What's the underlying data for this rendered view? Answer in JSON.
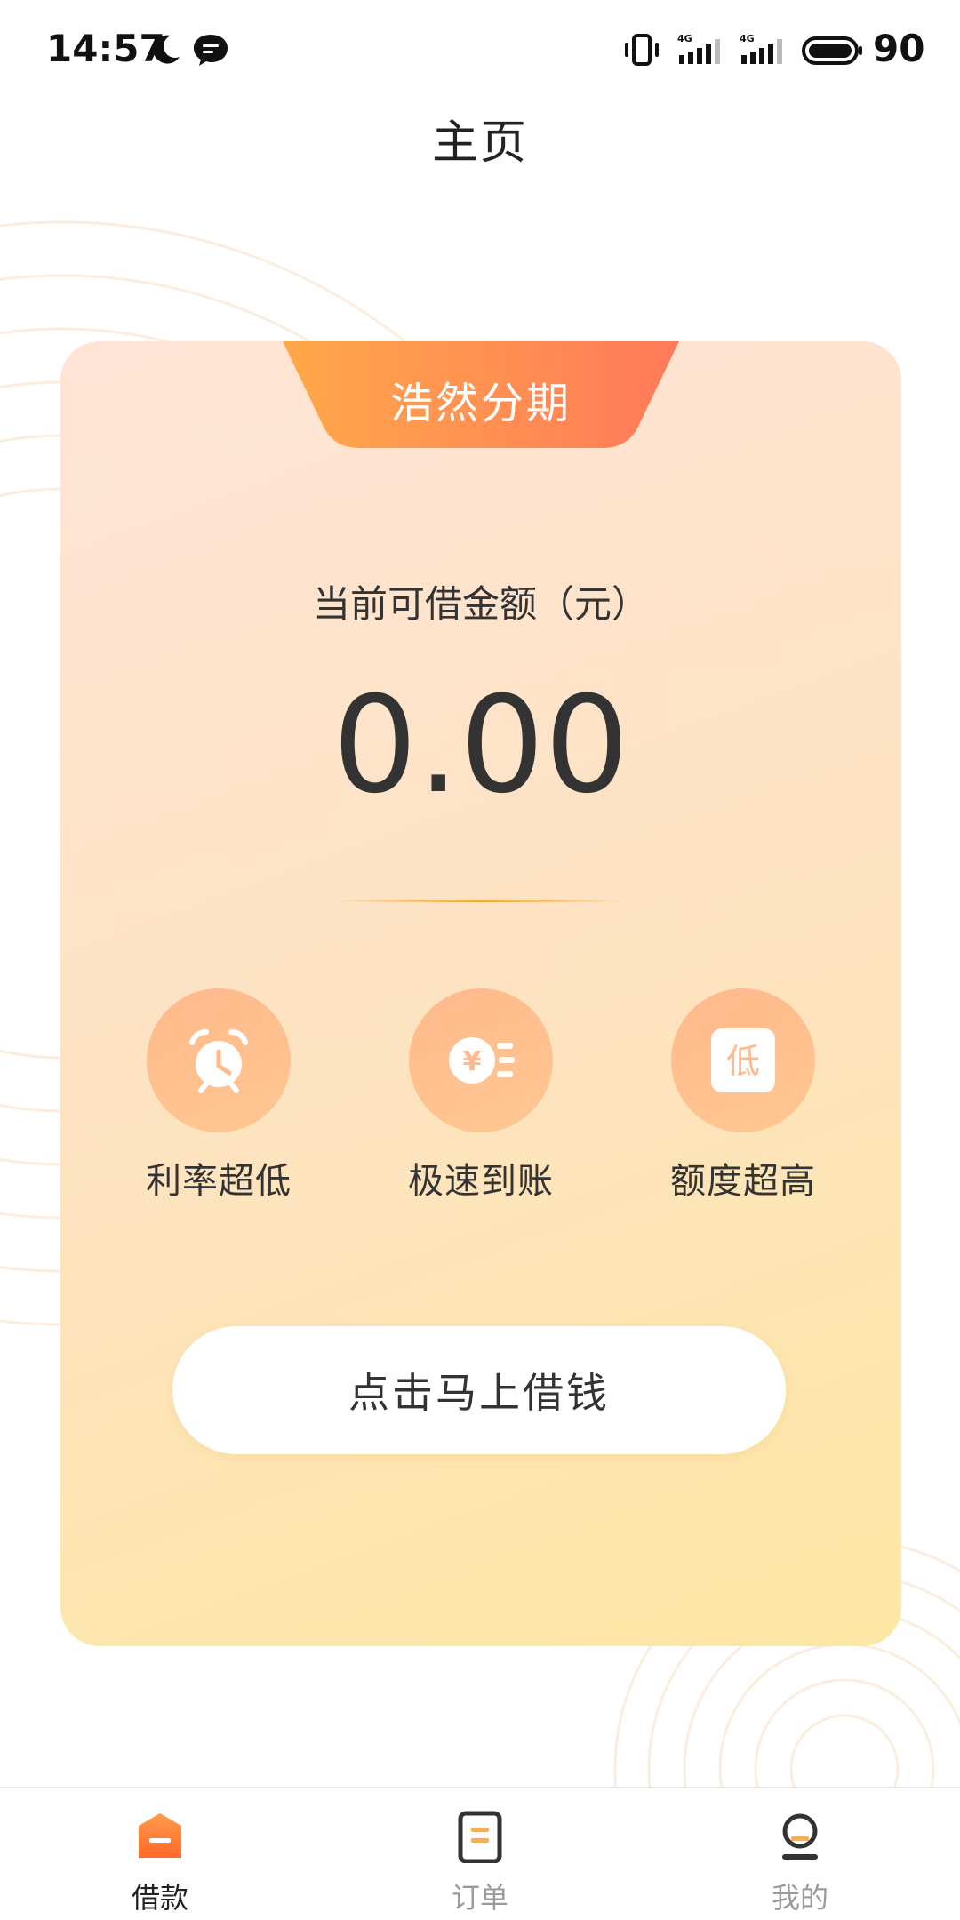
{
  "status_bar": {
    "time": "14:57",
    "battery": "90",
    "network_1": "4G",
    "network_2": "4G",
    "icons": [
      "moon-icon",
      "message-icon",
      "vibrate-icon",
      "signal-4g-icon",
      "signal-4g-icon",
      "battery-icon"
    ]
  },
  "header": {
    "title": "主页"
  },
  "card": {
    "tab_label": "浩然分期",
    "amount_label": "当前可借金额（元）",
    "amount_value": "0.00",
    "features": [
      {
        "label": "利率超低",
        "icon": "alarm-clock-icon"
      },
      {
        "label": "极速到账",
        "icon": "yen-coin-icon"
      },
      {
        "label": "额度超高",
        "icon": "low-badge-icon",
        "icon_text": "低"
      }
    ],
    "cta_label": "点击马上借钱"
  },
  "bottom_nav": {
    "items": [
      {
        "label": "借款",
        "icon": "loan-home-icon",
        "active": true
      },
      {
        "label": "订单",
        "icon": "order-doc-icon",
        "active": false
      },
      {
        "label": "我的",
        "icon": "profile-icon",
        "active": false
      }
    ]
  },
  "colors": {
    "accent_orange": "#ff8a3d",
    "tab_gradient_start": "#ffa849",
    "tab_gradient_end": "#ff7a5a",
    "card_top": "#ffe4d6",
    "card_bottom": "#fde7a4",
    "icon_circle": "#ffb98c",
    "text_dark": "#333333",
    "text_inactive": "#9a9a9a"
  }
}
